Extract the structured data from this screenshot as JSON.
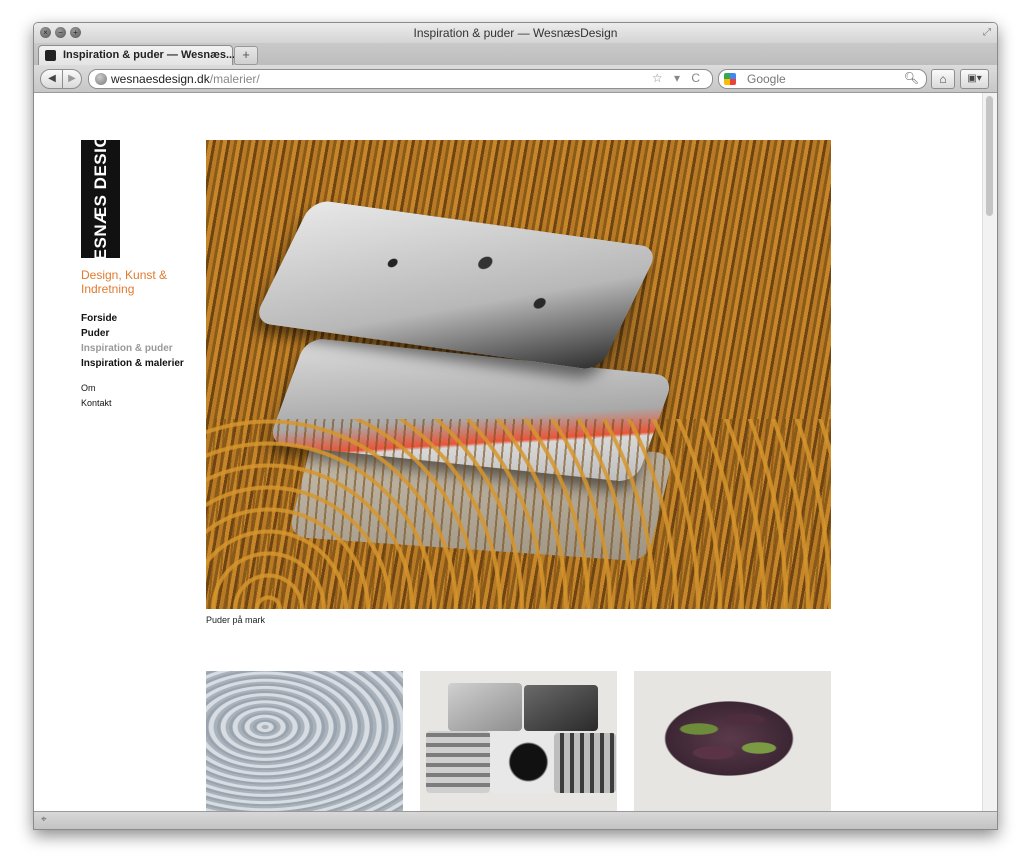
{
  "window": {
    "title": "Inspiration & puder — WesnæsDesign",
    "controls": [
      "close-icon",
      "minimize-icon",
      "zoom-icon"
    ]
  },
  "tab": {
    "label": "Inspiration & puder — Wesnæs...",
    "new_tab_label": "+"
  },
  "toolbar": {
    "back_label": "◀",
    "forward_label": "▶",
    "url_host": "wesnaesdesign.dk",
    "url_path": "/malerier/",
    "url_icons": "☆ ▾ C",
    "search_placeholder": "Google",
    "home_label": "⌂",
    "bookmarks_label": "▣▾"
  },
  "site": {
    "logo_text": "WESNÆS DESIGN",
    "tagline": "Design, Kunst & Indretning",
    "nav": [
      {
        "label": "Forside",
        "active": false
      },
      {
        "label": "Puder",
        "active": false
      },
      {
        "label": "Inspiration & puder",
        "active": true
      },
      {
        "label": "Inspiration & malerier",
        "active": false
      }
    ],
    "subnav": [
      {
        "label": "Om"
      },
      {
        "label": "Kontakt"
      }
    ],
    "hero_caption": "Puder på mark"
  },
  "colors": {
    "tagline": "#e07a2f",
    "active_nav": "#999999",
    "logo_bg": "#111111"
  }
}
